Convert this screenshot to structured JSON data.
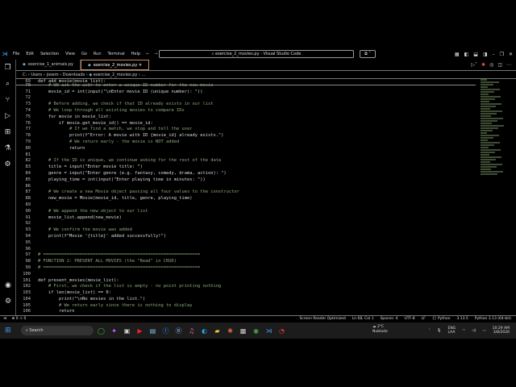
{
  "titlebar": {
    "menu": [
      "File",
      "Edit",
      "Selection",
      "View",
      "Go",
      "Run",
      "Terminal",
      "Help"
    ],
    "command_center": "exercise_2_movies.py - Visual Studio Code"
  },
  "tabs": [
    {
      "label": "exercise_1_animals.py",
      "active": false
    },
    {
      "label": "exercise_2_movies.py",
      "active": true
    }
  ],
  "breadcrumb": [
    "C:",
    "Users",
    "josem",
    "Downloads",
    "exercise_2_movies.py",
    "..."
  ],
  "code": {
    "sticky": {
      "no": "69",
      "text": "def add_movie(movie_list):"
    },
    "lines": [
      {
        "no": "70",
        "text": "    # We ask the user to enter a unique ID number for the new movie"
      },
      {
        "no": "71",
        "text": "    movie_id = int(input(\"\\nEnter movie ID (unique number): \"))"
      },
      {
        "no": "72",
        "text": ""
      },
      {
        "no": "73",
        "text": "    # Before adding, we check if that ID already exists in our list"
      },
      {
        "no": "74",
        "text": "    # We loop through all existing movies to compare IDs"
      },
      {
        "no": "75",
        "text": "    for movie in movie_list:"
      },
      {
        "no": "76",
        "text": "        if movie.get_movie_id() == movie_id:"
      },
      {
        "no": "77",
        "text": "            # If we find a match, we stop and tell the user"
      },
      {
        "no": "78",
        "text": "            print(f\"Error: A movie with ID {movie_id} already exists.\")"
      },
      {
        "no": "79",
        "text": "            # We return early - the movie is NOT added"
      },
      {
        "no": "80",
        "text": "            return"
      },
      {
        "no": "81",
        "text": ""
      },
      {
        "no": "82",
        "text": "    # If the ID is unique, we continue asking for the rest of the data"
      },
      {
        "no": "83",
        "text": "    title = input(\"Enter movie title: \")"
      },
      {
        "no": "84",
        "text": "    genre = input(\"Enter genre (e.g. fantasy, comedy, drama, action): \")"
      },
      {
        "no": "85",
        "text": "    playing_time = int(input(\"Enter playing time in minutes: \"))"
      },
      {
        "no": "86",
        "text": ""
      },
      {
        "no": "87",
        "text": "    # We create a new Movie object passing all four values to the constructor"
      },
      {
        "no": "88",
        "text": "    new_movie = Movie(movie_id, title, genre, playing_time)"
      },
      {
        "no": "89",
        "text": ""
      },
      {
        "no": "90",
        "text": "    # We append the new object to our list"
      },
      {
        "no": "91",
        "text": "    movie_list.append(new_movie)"
      },
      {
        "no": "92",
        "text": ""
      },
      {
        "no": "93",
        "text": "    # We confirm the movie was added"
      },
      {
        "no": "94",
        "text": "    print(f\"Movie '{title}' added successfully!\")"
      },
      {
        "no": "95",
        "text": ""
      },
      {
        "no": "96",
        "text": ""
      },
      {
        "no": "97",
        "text": "# ============================================================"
      },
      {
        "no": "98",
        "text": "# FUNCTION 2: PRESENT ALL MOVIES (the \"Read\" in CRUD)"
      },
      {
        "no": "99",
        "text": "# ============================================================"
      },
      {
        "no": "100",
        "text": ""
      },
      {
        "no": "101",
        "text": "def present_movies(movie_list):"
      },
      {
        "no": "102",
        "text": "    # First, we check if the list is empty - no point printing nothing"
      },
      {
        "no": "103",
        "text": "    if len(movie_list) == 0:"
      },
      {
        "no": "104",
        "text": "        print(\"\\nNo movies in the list.\")"
      },
      {
        "no": "105",
        "text": "        # We return early since there is nothing to display"
      },
      {
        "no": "106",
        "text": "        return"
      }
    ]
  },
  "status": {
    "left": [
      "⊗ 0 ⚠ 0"
    ],
    "right": [
      "Screen Reader Optimized",
      "Ln 68, Col 1",
      "Spaces: 4",
      "UTF-8",
      "LF",
      "{} Python",
      "3.13.5",
      "Python 3.13 (64-bit)"
    ]
  },
  "taskbar": {
    "search": "Search",
    "weather_temp": "2°C",
    "weather_desc": "Nublado",
    "lang": "ENG",
    "lang2": "LAA",
    "time": "10:29 AM",
    "date": "3/8/2026"
  },
  "colors": {
    "accent": "#3b9cf0",
    "comment": "#8aa878"
  }
}
